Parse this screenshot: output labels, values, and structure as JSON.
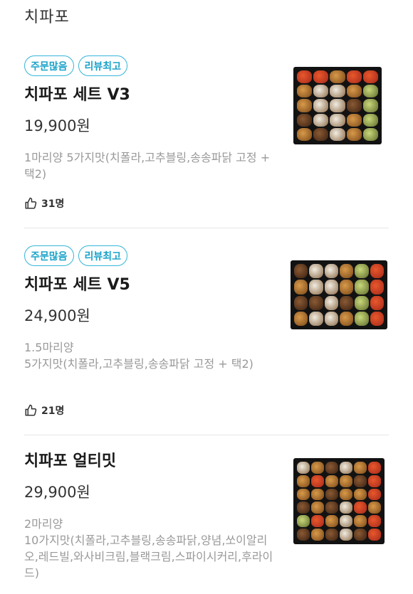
{
  "store": {
    "title": "치파포"
  },
  "menu": [
    {
      "badges": [
        "주문많음",
        "리뷰최고"
      ],
      "name": "치파포 세트 V3",
      "price": "19,900원",
      "description": "1마리양 5가지맛(치폴라,고추블링,송송파닭 고정 + 택2)",
      "likes": "31명",
      "image": "chicken-set-photo"
    },
    {
      "badges": [
        "주문많음",
        "리뷰최고"
      ],
      "name": "치파포 세트 V5",
      "price": "24,900원",
      "description_lines": [
        "1.5마리양",
        "5가지맛(치폴라,고추블링,송송파닭 고정 + 택2)"
      ],
      "likes": "21명",
      "image": "chicken-set-photo"
    },
    {
      "badges": [],
      "name": "치파포 얼티밋",
      "price": "29,900원",
      "description_lines": [
        "2마리양",
        "10가지맛(치폴라,고추블링,송송파닭,양념,쏘이알리오,레드빌,와사비크림,블랙크림,스파이시커리,후라이드)"
      ],
      "image": "chicken-set-photo"
    }
  ],
  "colors": {
    "badge_accent": "#36b6d9",
    "muted_text": "#999999"
  },
  "icons": {
    "like": "thumbs-up-icon"
  }
}
